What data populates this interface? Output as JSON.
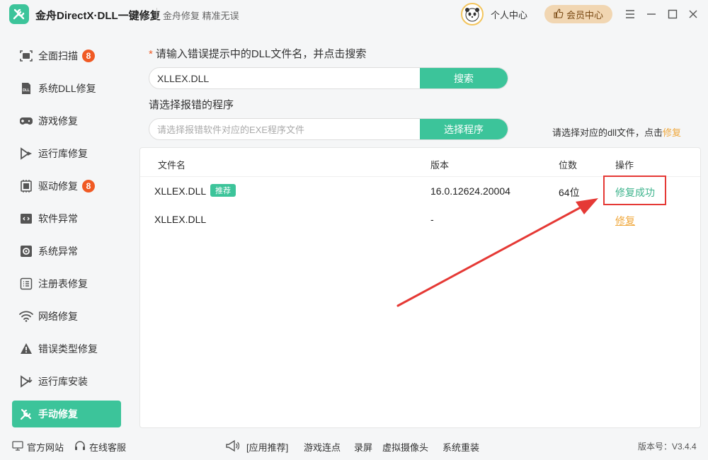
{
  "app": {
    "title": "金舟DirectX·DLL一键修复",
    "slogan": "金舟修复 精准无误"
  },
  "header": {
    "user_center": "个人中心",
    "vip_center": "会员中心"
  },
  "sidebar": {
    "items": [
      {
        "label": "全面扫描",
        "icon": "scan-icon",
        "badge": "8"
      },
      {
        "label": "系统DLL修复",
        "icon": "dll-icon",
        "badge": ""
      },
      {
        "label": "游戏修复",
        "icon": "gamepad-icon",
        "badge": ""
      },
      {
        "label": "运行库修复",
        "icon": "runtime-icon",
        "badge": ""
      },
      {
        "label": "驱动修复",
        "icon": "driver-icon",
        "badge": "8"
      },
      {
        "label": "软件异常",
        "icon": "code-icon",
        "badge": ""
      },
      {
        "label": "系统异常",
        "icon": "gear-icon",
        "badge": ""
      },
      {
        "label": "注册表修复",
        "icon": "list-icon",
        "badge": ""
      },
      {
        "label": "网络修复",
        "icon": "wifi-icon",
        "badge": ""
      },
      {
        "label": "错误类型修复",
        "icon": "warning-icon",
        "badge": ""
      },
      {
        "label": "运行库安装",
        "icon": "install-icon",
        "badge": ""
      },
      {
        "label": "手动修复",
        "icon": "wrench-icon",
        "badge": "",
        "active": true
      }
    ]
  },
  "search": {
    "star": "*",
    "title": "请输入错误提示中的DLL文件名，并点击搜索",
    "value": "XLLEX.DLL",
    "button": "搜索"
  },
  "program": {
    "title": "请选择报错的程序",
    "placeholder": "请选择报错软件对应的EXE程序文件",
    "button": "选择程序"
  },
  "hint": {
    "text": "请选择对应的dll文件，点击",
    "link": "修复"
  },
  "table": {
    "headers": {
      "name": "文件名",
      "version": "版本",
      "bits": "位数",
      "action": "操作"
    },
    "rows": [
      {
        "name": "XLLEX.DLL",
        "tag": "推荐",
        "version": "16.0.12624.20004",
        "bits": "64位",
        "action": "修复成功"
      },
      {
        "name": "XLLEX.DLL",
        "tag": "",
        "version": "-",
        "bits": "",
        "action": "修复"
      }
    ]
  },
  "footer": {
    "website": "官方网站",
    "service": "在线客服",
    "links": [
      "[应用推荐]",
      "游戏连点",
      "录屏",
      "虚拟摄像头",
      "系统重装"
    ],
    "version": "版本号：V3.4.4"
  },
  "colors": {
    "accent": "#3cc49a",
    "badge": "#f05a24",
    "link": "#f0a83c",
    "annotation": "#e53935"
  }
}
